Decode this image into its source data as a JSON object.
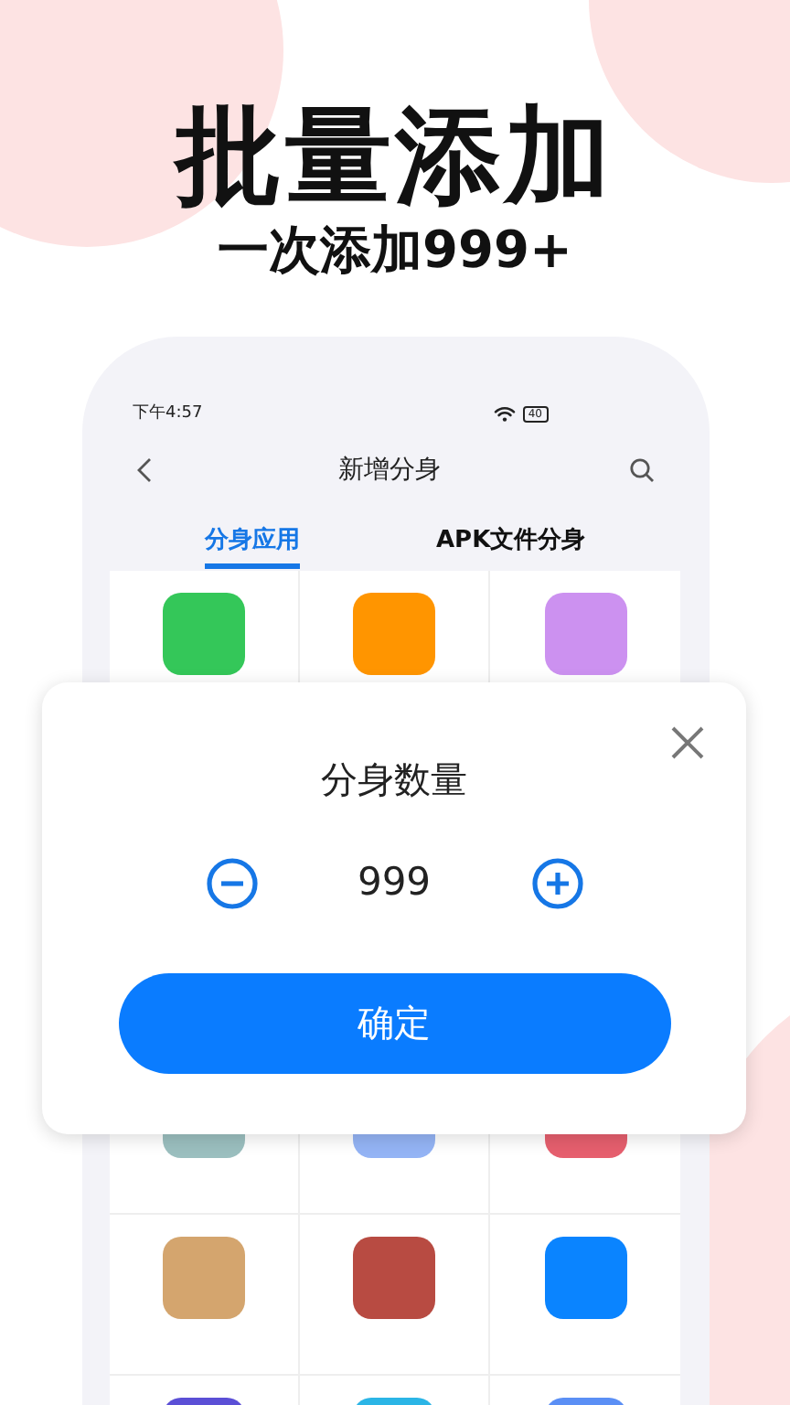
{
  "headline": "批量添加",
  "subheadline": "一次添加999+",
  "status_bar": {
    "time": "下午4:57",
    "battery": "40"
  },
  "nav": {
    "title": "新增分身"
  },
  "tabs": [
    {
      "label": "分身应用",
      "selected": true
    },
    {
      "label": "APK文件分身",
      "selected": false
    }
  ],
  "app_grid": {
    "rows": [
      {
        "kind": "tiles",
        "tiles": [
          {
            "color": "#34c759"
          },
          {
            "color": "#ff9500"
          },
          {
            "color": "#cc91f0"
          }
        ]
      },
      {
        "kind": "covered"
      },
      {
        "kind": "covered"
      },
      {
        "kind": "tiles",
        "tiles": [
          {
            "color": "#9bbfbf"
          },
          {
            "color": "#94b4f5"
          },
          {
            "color": "#e65f6e"
          }
        ]
      },
      {
        "kind": "tiles",
        "tiles": [
          {
            "color": "#d4a56e"
          },
          {
            "color": "#b84b42"
          },
          {
            "color": "#0a84ff"
          }
        ]
      },
      {
        "kind": "tiles",
        "tiles": [
          {
            "color": "#5b4fd6"
          },
          {
            "color": "#2bb5e6"
          },
          {
            "color": "#5b8ff5"
          }
        ]
      }
    ]
  },
  "dialog": {
    "title": "分身数量",
    "value": "999",
    "confirm": "确定"
  }
}
